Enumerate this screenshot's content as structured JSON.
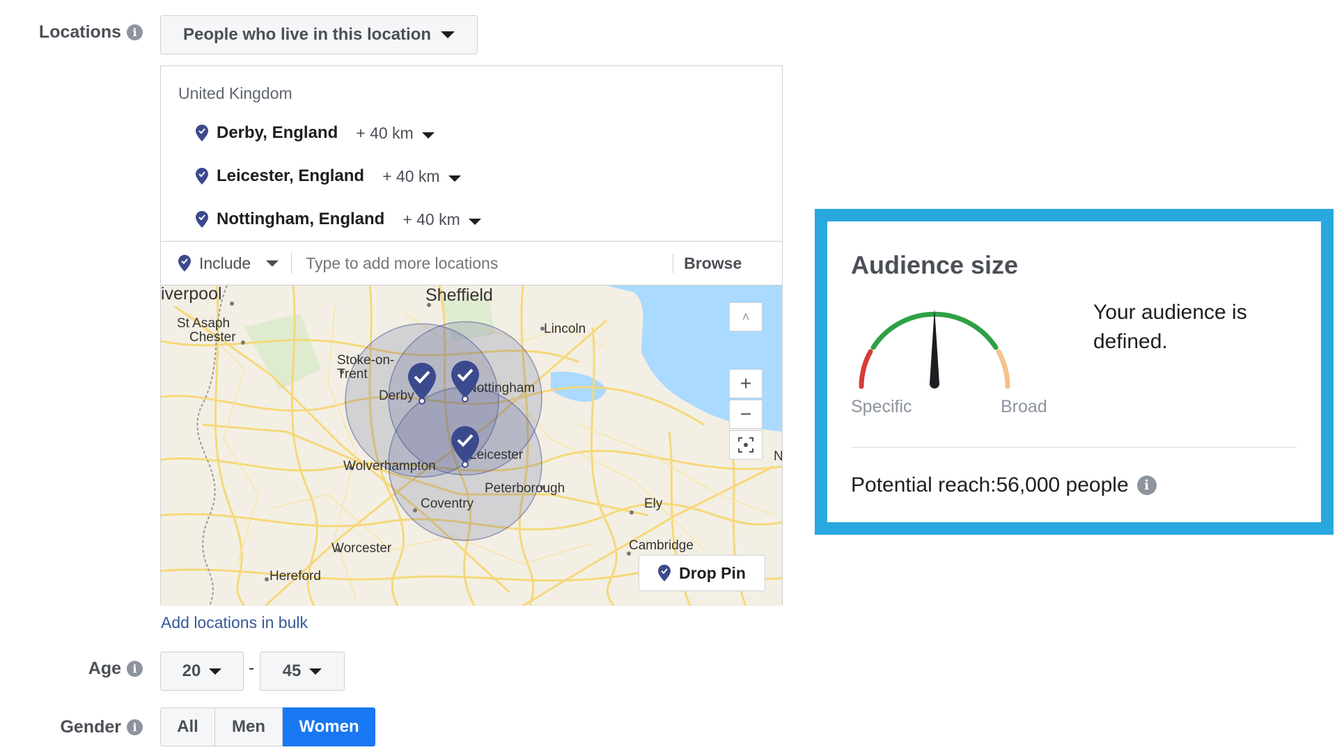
{
  "locations": {
    "label": "Locations",
    "mode_dropdown": "People who live in this location",
    "country": "United Kingdom",
    "items": [
      {
        "name": "Derby, England",
        "radius": "+ 40 km"
      },
      {
        "name": "Leicester, England",
        "radius": "+ 40 km"
      },
      {
        "name": "Nottingham, England",
        "radius": "+ 40 km"
      }
    ],
    "include_label": "Include",
    "search_placeholder": "Type to add more locations",
    "browse_label": "Browse",
    "bulk_link": "Add locations in bulk"
  },
  "map": {
    "labels": {
      "liverpool": "iverpool",
      "sheffield": "Sheffield",
      "st_asaph": "St Asaph",
      "chester": "Chester",
      "lincoln": "Lincoln",
      "stoke": "Stoke-on-",
      "trent": "Trent",
      "derby": "Derby",
      "nottingham": "Nottingham",
      "leicester": "Leicester",
      "wolverhampton": "Wolverhampton",
      "coventry": "Coventry",
      "peterborough": "Peterborough",
      "ely": "Ely",
      "worcester": "Worcester",
      "cambridge": "Cambridge",
      "hereford": "Hereford",
      "edge_n": "N"
    },
    "drop_pin_label": "Drop Pin",
    "zoom_in_symbol": "+",
    "zoom_out_symbol": "−",
    "collapse_symbol": "˄"
  },
  "age": {
    "label": "Age",
    "min": "20",
    "separator": "-",
    "max": "45"
  },
  "gender": {
    "label": "Gender",
    "options": [
      "All",
      "Men",
      "Women"
    ],
    "selected": "Women"
  },
  "audience": {
    "title": "Audience size",
    "status_text": "Your audience is defined.",
    "specific_label": "Specific",
    "broad_label": "Broad",
    "reach_text": "Potential reach:56,000 people",
    "gauge_colors": {
      "low": "#d93a3a",
      "mid": "#2ea043",
      "high": "#f5c28a",
      "needle": "#1c1e21"
    }
  },
  "colors": {
    "accent": "#1877f2",
    "highlight_border": "#29a8e0",
    "pin": "#3b4a8c",
    "link": "#365899"
  }
}
